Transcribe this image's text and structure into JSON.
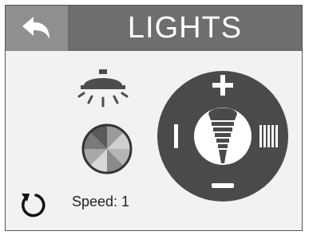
{
  "header": {
    "title": "LIGHTS"
  },
  "icons": {
    "back": "back-arrow-icon",
    "lamp": "ceiling-lamp-icon",
    "wheel": "color-wheel-icon",
    "reset": "reset-icon",
    "bulb": "light-bulb-icon"
  },
  "speed": {
    "label": "Speed: 1"
  },
  "dial": {
    "increase": "+",
    "decrease": "−"
  },
  "colors": {
    "header": "#6e6e6e",
    "back_button": "#8f8f8f",
    "dial": "#4a4a4a",
    "background": "#f2f2f2"
  }
}
